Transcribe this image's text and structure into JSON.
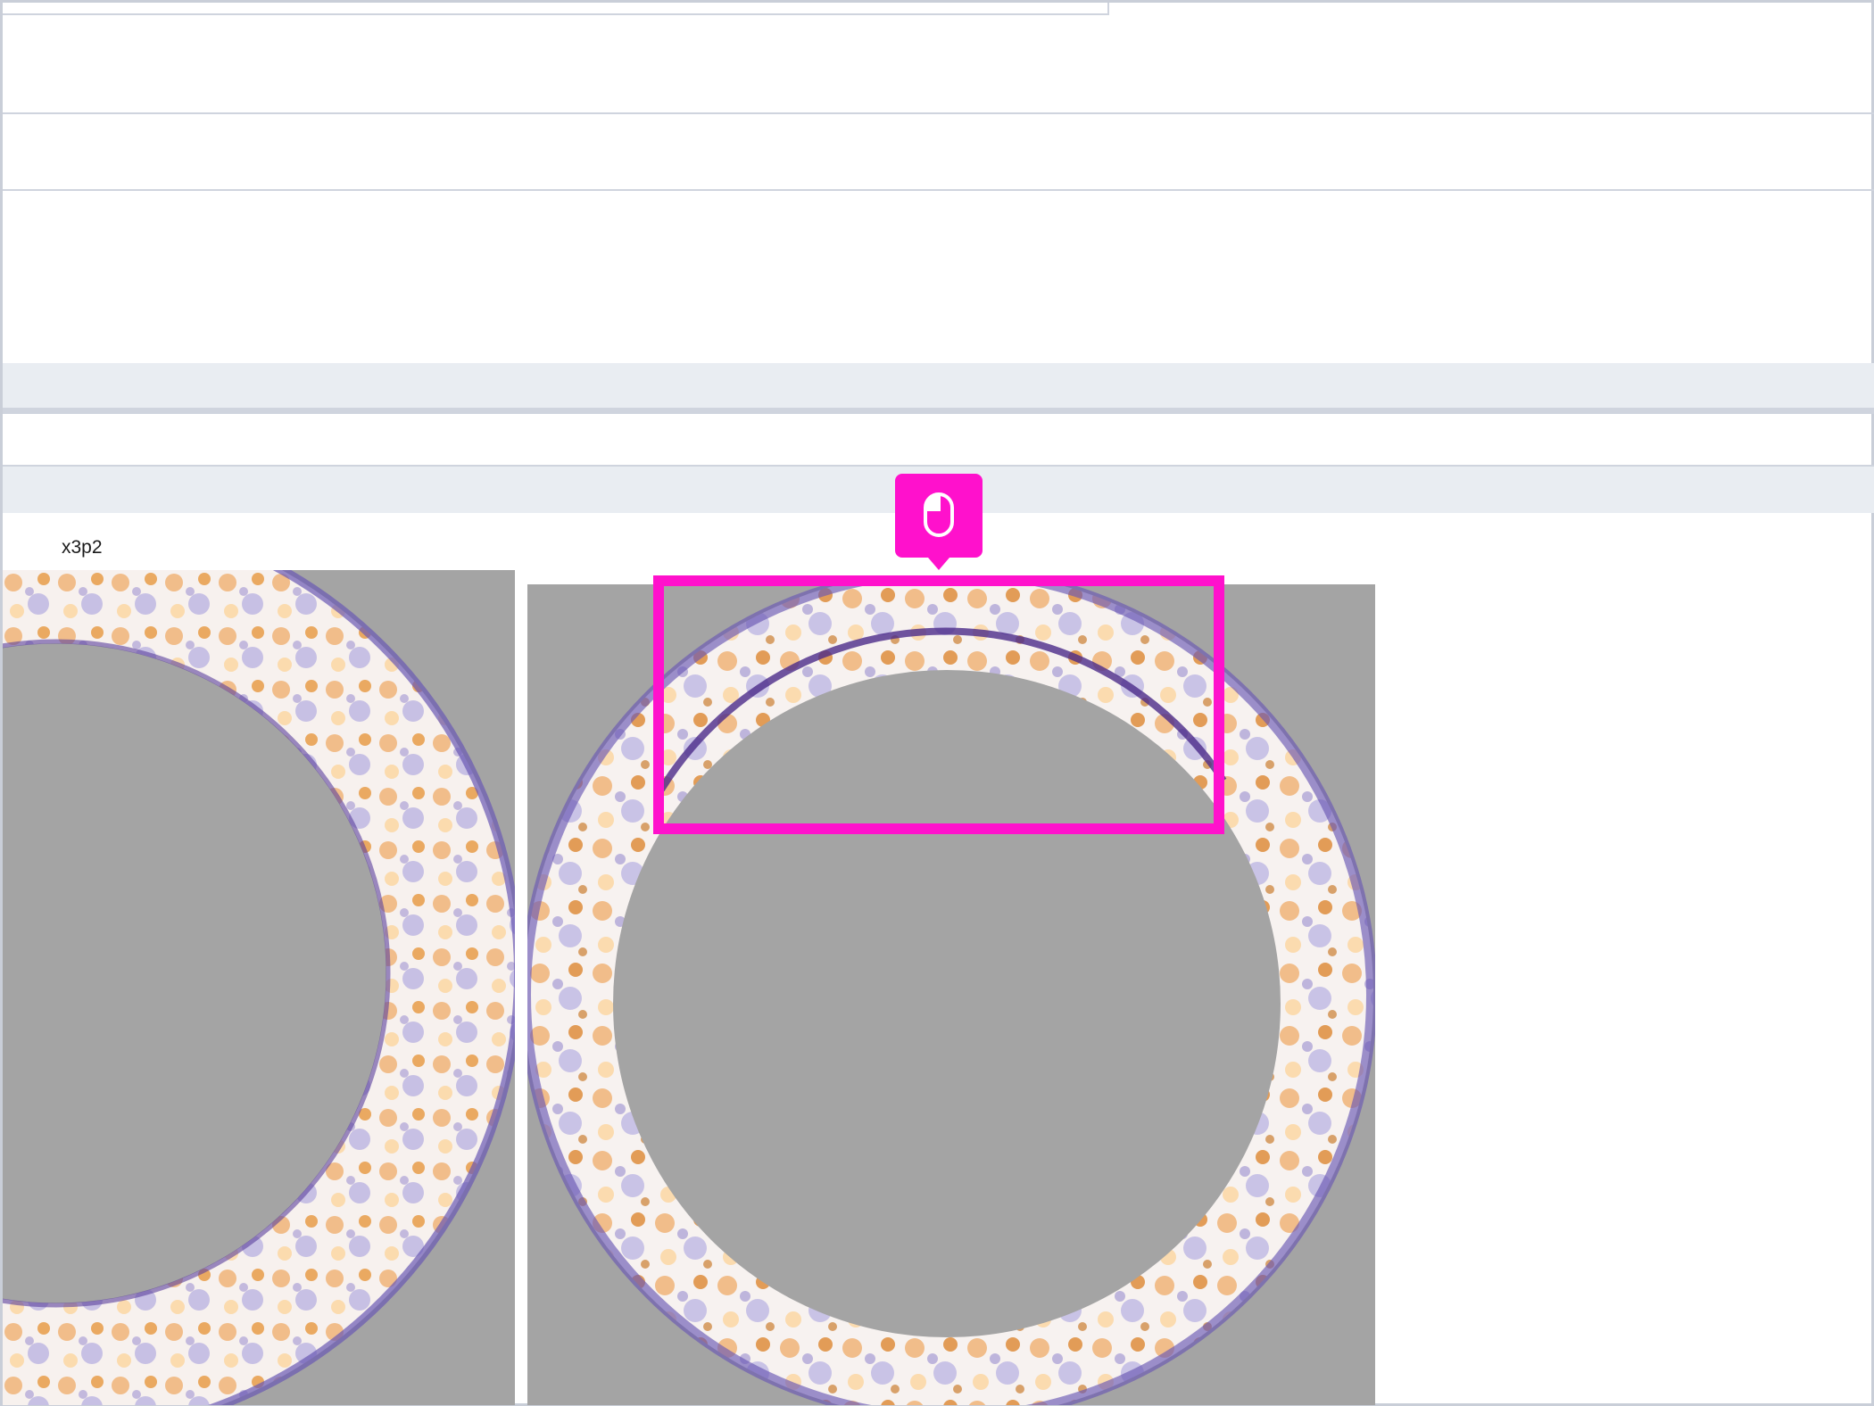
{
  "panels": [
    {
      "label": "x3p2"
    },
    {
      "label": ""
    }
  ],
  "icons": {
    "cursor": "mouse-click-icon"
  },
  "colors": {
    "highlight": "#ff11cc",
    "image_background": "#a4a4a4",
    "colormap_low": "#4b2a8a",
    "colormap_mid": "#f5f5fa",
    "colormap_high": "#c8660a",
    "band": "#e9edf2",
    "divider": "#cfd4de"
  }
}
